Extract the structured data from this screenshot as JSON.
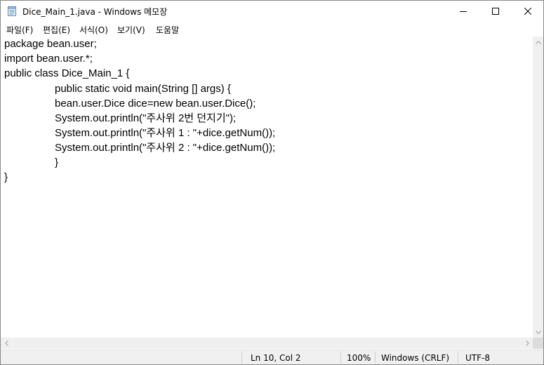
{
  "window": {
    "title": "Dice_Main_1.java - Windows 메모장",
    "icons": {
      "app": "notepad-icon",
      "minimize": "minimize-icon",
      "maximize": "maximize-icon",
      "close": "close-icon"
    }
  },
  "menu": {
    "items": [
      "파일(F)",
      "편집(E)",
      "서식(O)",
      "보기(V)",
      "도움말"
    ]
  },
  "editor": {
    "lines": [
      "package bean.user;",
      "import bean.user.*;",
      "public class Dice_Main_1 {",
      "public static void main(String [] args) {",
      "bean.user.Dice dice=new bean.user.Dice();",
      "System.out.println(\"주사위 2번 던지기\");",
      "System.out.println(\"주사위 1 : \"+dice.getNum());",
      "System.out.println(\"주사위 2 : \"+dice.getNum());",
      "}",
      "}"
    ]
  },
  "status": {
    "position": "Ln 10, Col 2",
    "zoom": "100%",
    "line_ending": "Windows (CRLF)",
    "encoding": "UTF-8"
  }
}
